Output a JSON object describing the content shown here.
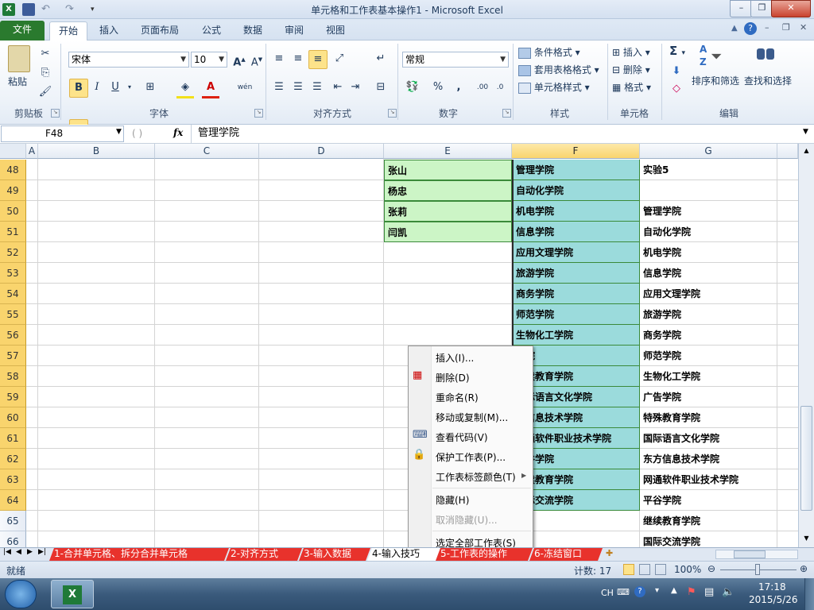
{
  "window": {
    "title": "单元格和工作表基本操作1 - Microsoft Excel"
  },
  "ribbon_tabs": {
    "file": "文件",
    "home": "开始",
    "insert": "插入",
    "page_layout": "页面布局",
    "formulas": "公式",
    "data": "数据",
    "review": "审阅",
    "view": "视图"
  },
  "ribbon": {
    "clipboard": {
      "paste": "粘贴",
      "group": "剪贴板"
    },
    "font": {
      "name": "宋体",
      "size": "10",
      "bold": "B",
      "italic": "I",
      "underline": "U",
      "color_letter": "A",
      "wen": "wén",
      "group": "字体"
    },
    "alignment": {
      "group": "对齐方式"
    },
    "number": {
      "format": "常规",
      "percent": "%",
      "comma": ",",
      "group": "数字"
    },
    "styles": {
      "conditional": "条件格式",
      "table": "套用表格格式",
      "cell_styles": "单元格样式",
      "group": "样式"
    },
    "cells": {
      "insert": "插入",
      "delete": "删除",
      "format": "格式",
      "group": "单元格"
    },
    "editing": {
      "sum": "Σ",
      "sort_filter": "排序和筛选",
      "find_select": "查找和选择",
      "group": "编辑"
    }
  },
  "formula_bar": {
    "name_box": "F48",
    "fx": "fx",
    "content": "管理学院"
  },
  "columns": [
    "A",
    "B",
    "C",
    "D",
    "E",
    "F",
    "G"
  ],
  "rows": [
    "48",
    "49",
    "50",
    "51",
    "52",
    "53",
    "54",
    "55",
    "56",
    "57",
    "58",
    "59",
    "60",
    "61",
    "62",
    "63",
    "64",
    "65",
    "66"
  ],
  "cells": {
    "E": [
      "张山",
      "杨忠",
      "张莉",
      "闫凯"
    ],
    "F": [
      "管理学院",
      "自动化学院",
      "机电学院",
      "信息学院",
      "应用文理学院",
      "旅游学院",
      "商务学院",
      "师范学院",
      "生物化工学院",
      "学院",
      "继续教育学院",
      "国际语言文化学院",
      "方信息技术学院",
      "网通软件职业技术学院",
      "平谷学院",
      "继续教育学院",
      "国际交流学院"
    ],
    "G": [
      "实验5",
      "",
      "管理学院",
      "自动化学院",
      "机电学院",
      "信息学院",
      "应用文理学院",
      "旅游学院",
      "商务学院",
      "师范学院",
      "生物化工学院",
      "广告学院",
      "特殊教育学院",
      "国际语言文化学院",
      "东方信息技术学院",
      "网通软件职业技术学院",
      "平谷学院",
      "继续教育学院",
      "国际交流学院"
    ]
  },
  "context_menu": [
    {
      "label": "插入(I)...",
      "disabled": false
    },
    {
      "label": "删除(D)",
      "disabled": false
    },
    {
      "label": "重命名(R)",
      "disabled": false
    },
    {
      "label": "移动或复制(M)...",
      "disabled": false
    },
    {
      "label": "查看代码(V)",
      "disabled": false
    },
    {
      "label": "保护工作表(P)...",
      "disabled": false
    },
    {
      "label": "工作表标签颜色(T)",
      "disabled": false
    },
    {
      "label": "隐藏(H)",
      "disabled": false
    },
    {
      "label": "取消隐藏(U)...",
      "disabled": true
    },
    {
      "label": "选定全部工作表(S)",
      "disabled": false
    }
  ],
  "sheet_tabs": [
    {
      "label": "1-合并单元格、拆分合并单元格",
      "active": false
    },
    {
      "label": "2-对齐方式",
      "active": false
    },
    {
      "label": "3-输入数据",
      "active": false
    },
    {
      "label": "4-输入技巧",
      "active": true
    },
    {
      "label": "5-工作表的操作",
      "active": false
    },
    {
      "label": "6-冻结窗口",
      "active": false
    }
  ],
  "status": {
    "ready": "就绪",
    "count": "计数: 17",
    "zoom": "100%"
  },
  "taskbar": {
    "lang": "CH",
    "time": "17:18",
    "date": "2015/5/26"
  },
  "colors": {
    "selected_header": "#f9d46d",
    "range_e": "#ccf5c6",
    "range_f": "#9bdbdc",
    "tab_red": "#e8322c",
    "file_tab": "#2a7a2e"
  }
}
